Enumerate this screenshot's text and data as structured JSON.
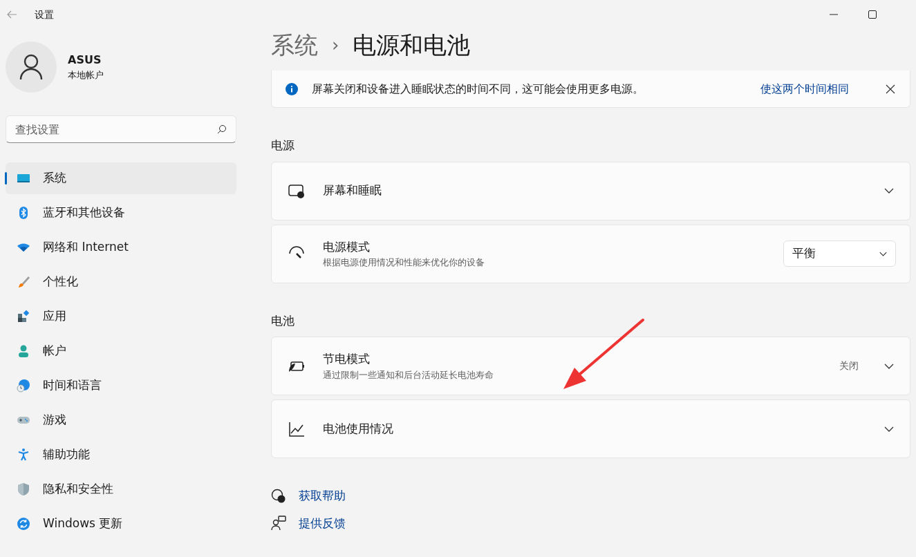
{
  "window": {
    "title": "设置"
  },
  "account": {
    "name": "ASUS",
    "type": "本地帐户"
  },
  "search": {
    "placeholder": "查找设置"
  },
  "sidebar": {
    "items": [
      {
        "label": "系统",
        "selected": true
      },
      {
        "label": "蓝牙和其他设备",
        "selected": false
      },
      {
        "label": "网络和 Internet",
        "selected": false
      },
      {
        "label": "个性化",
        "selected": false
      },
      {
        "label": "应用",
        "selected": false
      },
      {
        "label": "帐户",
        "selected": false
      },
      {
        "label": "时间和语言",
        "selected": false
      },
      {
        "label": "游戏",
        "selected": false
      },
      {
        "label": "辅助功能",
        "selected": false
      },
      {
        "label": "隐私和安全性",
        "selected": false
      },
      {
        "label": "Windows 更新",
        "selected": false
      }
    ]
  },
  "breadcrumb": {
    "parent": "系统",
    "separator": "›",
    "current": "电源和电池"
  },
  "info_bar": {
    "message": "屏幕关闭和设备进入睡眠状态的时间不同，这可能会使用更多电源。",
    "action": "使这两个时间相同"
  },
  "sections": [
    {
      "title": "电源",
      "cards": [
        {
          "kind": "expander",
          "title": "屏幕和睡眠"
        },
        {
          "kind": "dropdown",
          "title": "电源模式",
          "description": "根据电源使用情况和性能来优化你的设备",
          "value": "平衡"
        }
      ]
    },
    {
      "title": "电池",
      "cards": [
        {
          "kind": "expander",
          "title": "节电模式",
          "description": "通过限制一些通知和后台活动延长电池寿命",
          "status": "关闭"
        },
        {
          "kind": "expander",
          "title": "电池使用情况"
        }
      ]
    }
  ],
  "help_links": [
    "获取帮助",
    "提供反馈"
  ]
}
